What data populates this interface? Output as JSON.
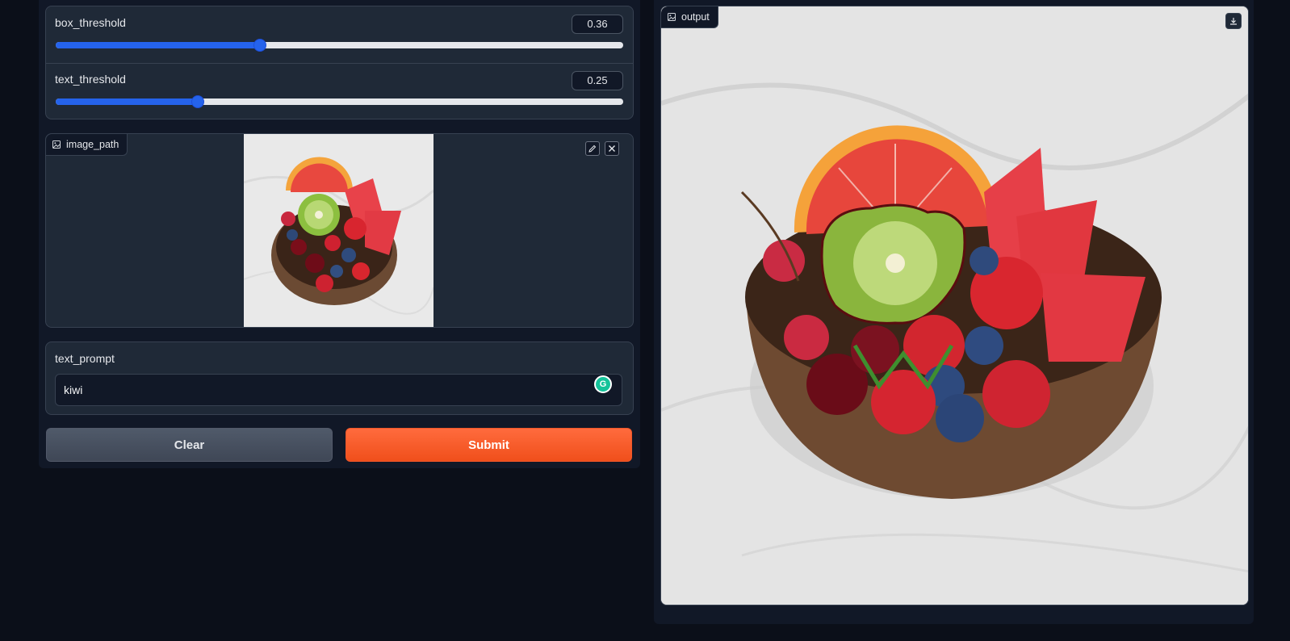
{
  "sliders": [
    {
      "label": "box_threshold",
      "value": "0.36",
      "fraction": 0.36
    },
    {
      "label": "text_threshold",
      "value": "0.25",
      "fraction": 0.25
    }
  ],
  "image_input": {
    "label": "image_path",
    "icon": "image-icon"
  },
  "text_prompt": {
    "label": "text_prompt",
    "value": "kiwi",
    "extension_icon": "grammarly-icon",
    "extension_glyph": "G"
  },
  "buttons": {
    "clear": "Clear",
    "submit": "Submit"
  },
  "output": {
    "label": "output",
    "icon": "image-icon"
  },
  "colors": {
    "accent": "#2563eb",
    "submit": "#f4571f",
    "background": "#0b0f19",
    "panel": "#1f2937"
  }
}
